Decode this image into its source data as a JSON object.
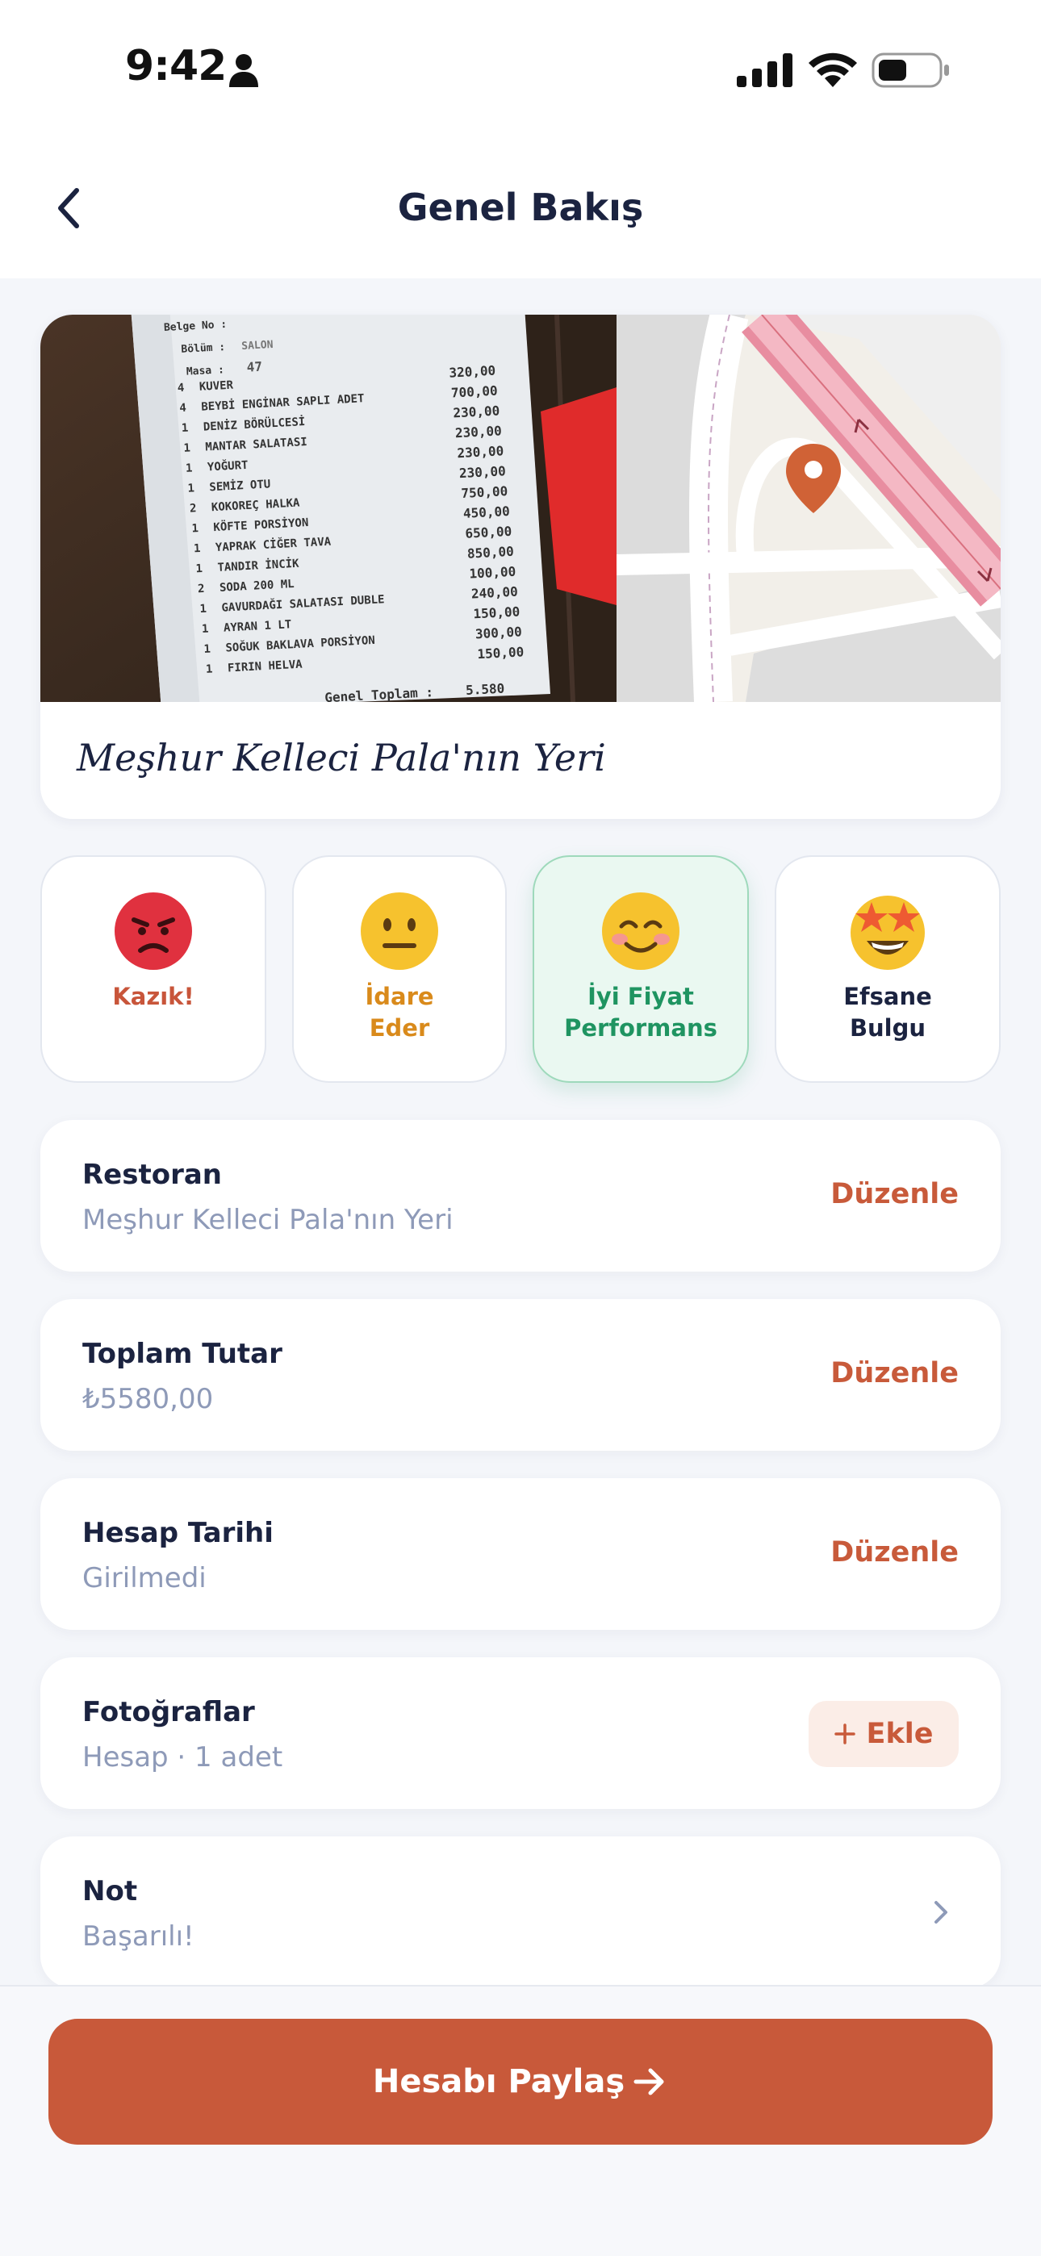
{
  "status_bar": {
    "time": "9:42"
  },
  "nav": {
    "title": "Genel Bakış"
  },
  "restaurant": {
    "name": "Meşhur Kelleci Pala'nın Yeri"
  },
  "receipt": {
    "belge_no": "Belge No :",
    "bolum": "Bölüm :",
    "bolum_value": "SALON",
    "masa": "Masa :",
    "masa_value": "47",
    "items": [
      {
        "qty": "4",
        "name": "KUVER",
        "price": "320,00"
      },
      {
        "qty": "4",
        "name": "BEYBİ ENGİNAR SAPLI ADET",
        "price": "700,00"
      },
      {
        "qty": "1",
        "name": "DENİZ BÖRÜLCESİ",
        "price": "230,00"
      },
      {
        "qty": "1",
        "name": "MANTAR SALATASI",
        "price": "230,00"
      },
      {
        "qty": "1",
        "name": "YOĞURT",
        "price": "230,00"
      },
      {
        "qty": "1",
        "name": "SEMİZ OTU",
        "price": "230,00"
      },
      {
        "qty": "2",
        "name": "KOKOREÇ HALKA",
        "price": "750,00"
      },
      {
        "qty": "1",
        "name": "KÖFTE PORSİYON",
        "price": "450,00"
      },
      {
        "qty": "1",
        "name": "YAPRAK CİĞER TAVA",
        "price": "650,00"
      },
      {
        "qty": "1",
        "name": "TANDIR İNCİK",
        "price": "850,00"
      },
      {
        "qty": "2",
        "name": "SODA 200 ML",
        "price": "100,00"
      },
      {
        "qty": "1",
        "name": "GAVURDAĞI SALATASI DUBLE",
        "price": "240,00"
      },
      {
        "qty": "1",
        "name": "AYRAN 1 LT",
        "price": "150,00"
      },
      {
        "qty": "1",
        "name": "SOĞUK BAKLAVA PORSİYON",
        "price": "300,00"
      },
      {
        "qty": "1",
        "name": "FIRIN HELVA",
        "price": "150,00"
      }
    ],
    "total_label": "Genel Toplam :",
    "total_value": "5.580"
  },
  "ratings": [
    {
      "label": "Kazık!",
      "icon": "angry-face-icon",
      "color": "#C8553A"
    },
    {
      "label": "İdare\nEder",
      "icon": "neutral-face-icon",
      "color": "#D98A1B"
    },
    {
      "label": "İyi Fiyat\nPerformans",
      "icon": "smiling-face-icon",
      "color": "#1F9461",
      "selected": true
    },
    {
      "label": "Efsane\nBulgu",
      "icon": "star-struck-face-icon",
      "color": "#1B2340"
    }
  ],
  "fields": {
    "restaurant": {
      "label": "Restoran",
      "value": "Meşhur Kelleci Pala'nın Yeri",
      "action": "Düzenle"
    },
    "total": {
      "label": "Toplam Tutar",
      "value": "₺5580,00",
      "action": "Düzenle"
    },
    "date": {
      "label": "Hesap Tarihi",
      "value": "Girilmedi",
      "action": "Düzenle"
    },
    "photos": {
      "label": "Fotoğraflar",
      "value": "Hesap · 1 adet",
      "action": "Ekle"
    },
    "note": {
      "label": "Not",
      "value": "Başarılı!"
    }
  },
  "share_button": {
    "label": "Hesabı Paylaş"
  },
  "colors": {
    "accent": "#C8593A",
    "background": "#F4F6FA",
    "text_dark": "#1B2340",
    "text_muted": "#8E9AB8",
    "selected_bg": "#EAF8F1"
  }
}
